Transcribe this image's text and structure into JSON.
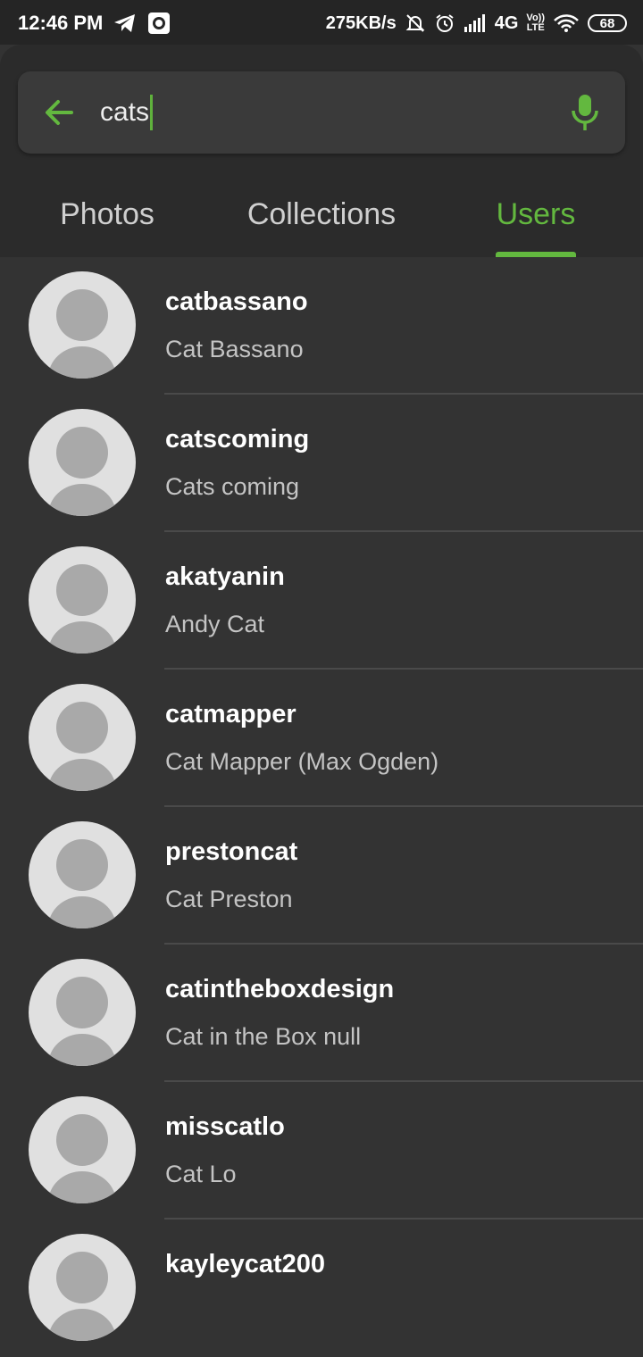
{
  "status_bar": {
    "time": "12:46 PM",
    "network_speed": "275KB/s",
    "network_type": "4G",
    "volte_top": "Vo))",
    "volte_bottom": "LTE",
    "battery": "68",
    "icons": [
      "telegram-icon",
      "camera-icon",
      "mute-bell-icon",
      "alarm-icon",
      "signal-icon",
      "wifi-icon",
      "battery-icon"
    ]
  },
  "search": {
    "query": "cats",
    "back_icon": "arrow-left-icon",
    "mic_icon": "microphone-icon"
  },
  "tabs": [
    {
      "label": "Photos",
      "active": false
    },
    {
      "label": "Collections",
      "active": false
    },
    {
      "label": "Users",
      "active": true
    }
  ],
  "colors": {
    "accent": "#63b83f",
    "background": "#333333",
    "header": "#2b2b2b"
  },
  "users": [
    {
      "username": "catbassano",
      "name": "Cat Bassano"
    },
    {
      "username": "catscoming",
      "name": "Cats coming"
    },
    {
      "username": "akatyanin",
      "name": "Andy Cat"
    },
    {
      "username": "catmapper",
      "name": "Cat Mapper (Max Ogden)"
    },
    {
      "username": "prestoncat",
      "name": "Cat Preston"
    },
    {
      "username": "catintheboxdesign",
      "name": "Cat in the Box null"
    },
    {
      "username": "misscatlo",
      "name": "Cat Lo"
    },
    {
      "username": "kayleycat200",
      "name": ""
    }
  ]
}
